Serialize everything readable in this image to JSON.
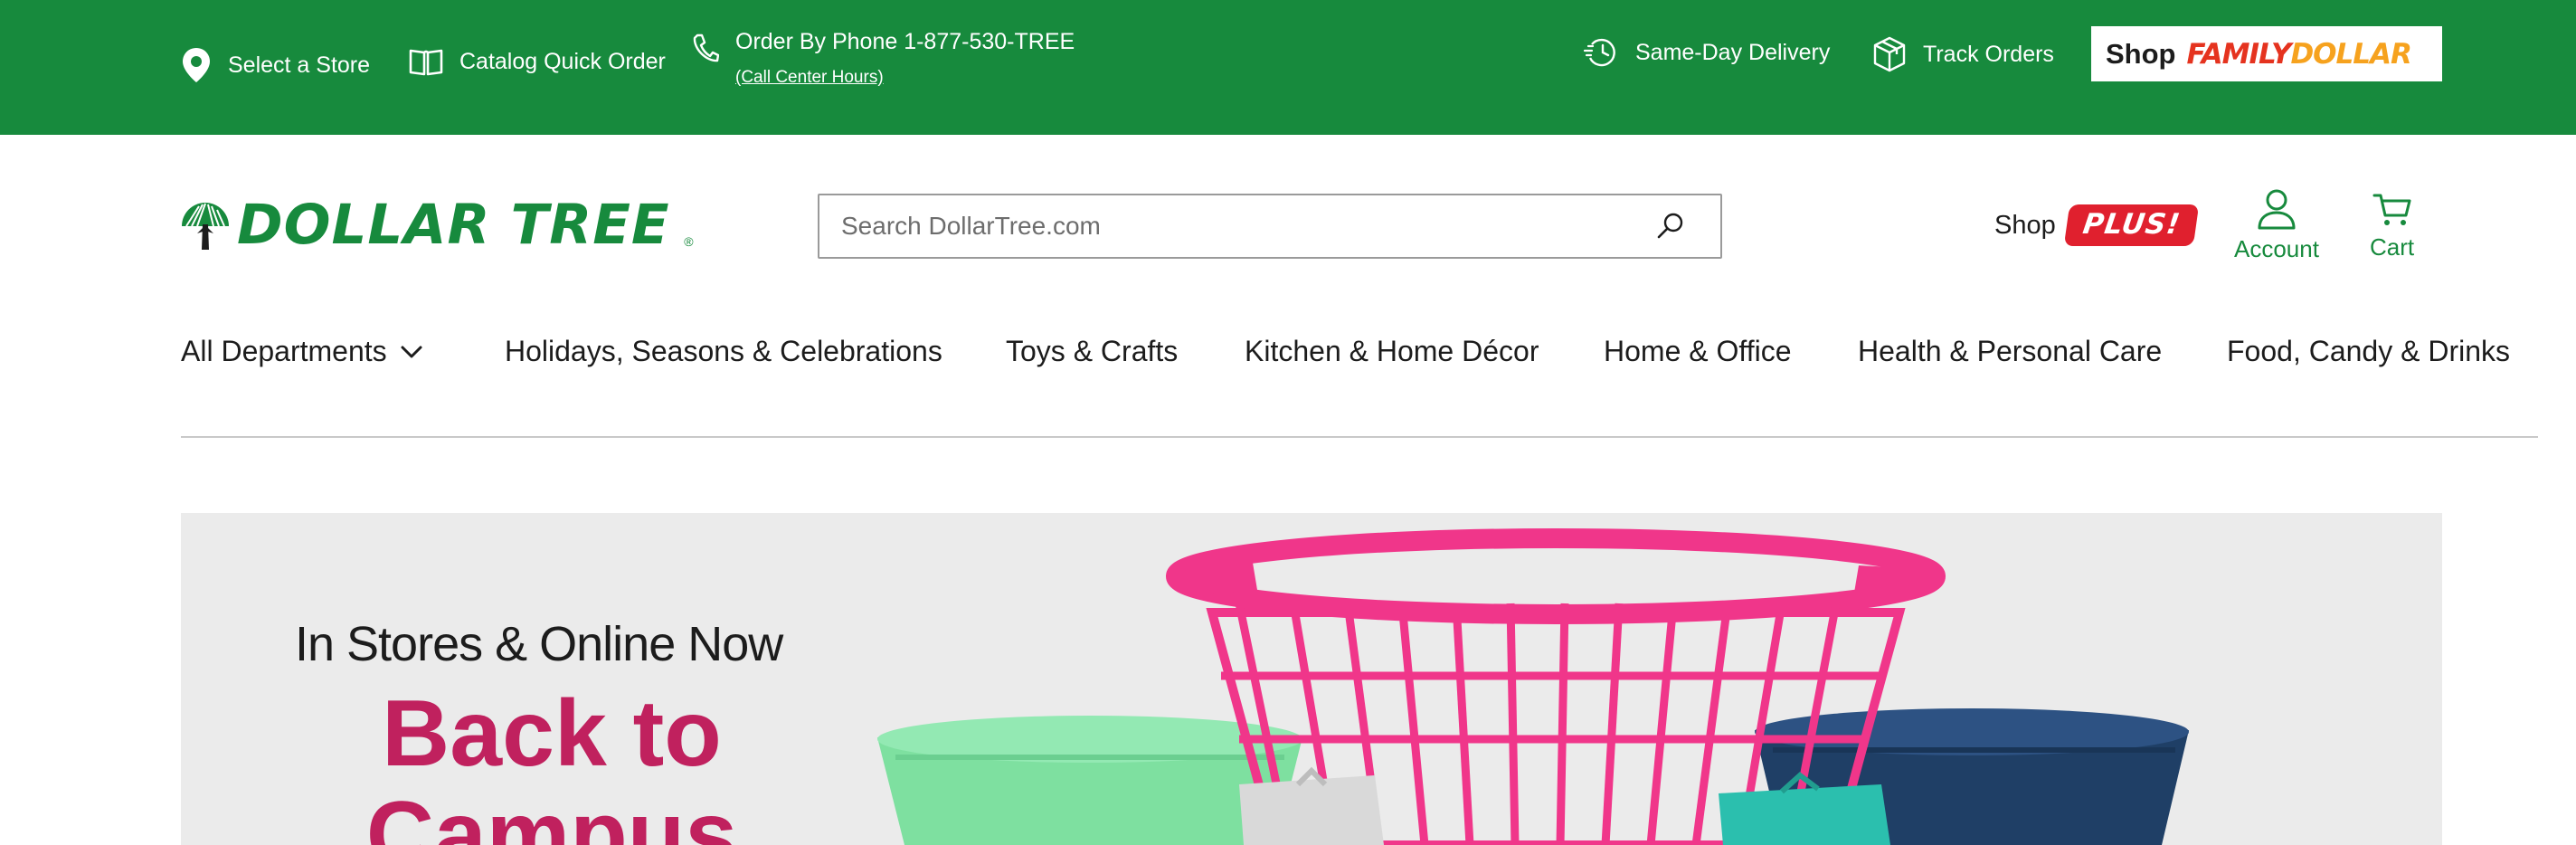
{
  "topbar": {
    "select_store": "Select a Store",
    "catalog_order": "Catalog Quick Order",
    "phone_order": "Order By Phone 1-877-530-TREE",
    "call_center_hours": "(Call Center Hours)",
    "same_day_delivery": "Same-Day Delivery",
    "track_orders": "Track Orders",
    "family_dollar": {
      "shop_label": "Shop",
      "logo_part1": "FAMILY",
      "logo_part2": "DOLLAR"
    }
  },
  "header": {
    "logo_text": "DOLLAR TREE",
    "logo_reg": "®",
    "search_placeholder": "Search DollarTree.com",
    "plus": {
      "shop_label": "Shop",
      "badge": "PLUS!"
    },
    "account_label": "Account",
    "cart_label": "Cart"
  },
  "nav": {
    "items": [
      "All Departments",
      "Holidays, Seasons & Celebrations",
      "Toys & Crafts",
      "Kitchen & Home Décor",
      "Home & Office",
      "Health & Personal Care",
      "Food, Candy & Drinks"
    ]
  },
  "hero": {
    "subtitle": "In Stores & Online Now",
    "title_line1": "Back to",
    "title_line2": "Campus"
  },
  "colors": {
    "brand_green": "#178a3d",
    "plus_red": "#e0202e",
    "hero_pink": "#c0215e",
    "hero_bg": "#ebebeb"
  },
  "icons": {
    "store": "map-pin-icon",
    "catalog": "open-book-icon",
    "phone": "phone-icon",
    "delivery": "clock-arrow-icon",
    "track": "package-box-icon",
    "search": "search-icon",
    "account": "user-icon",
    "cart": "cart-icon",
    "dropdown": "chevron-down-icon"
  }
}
